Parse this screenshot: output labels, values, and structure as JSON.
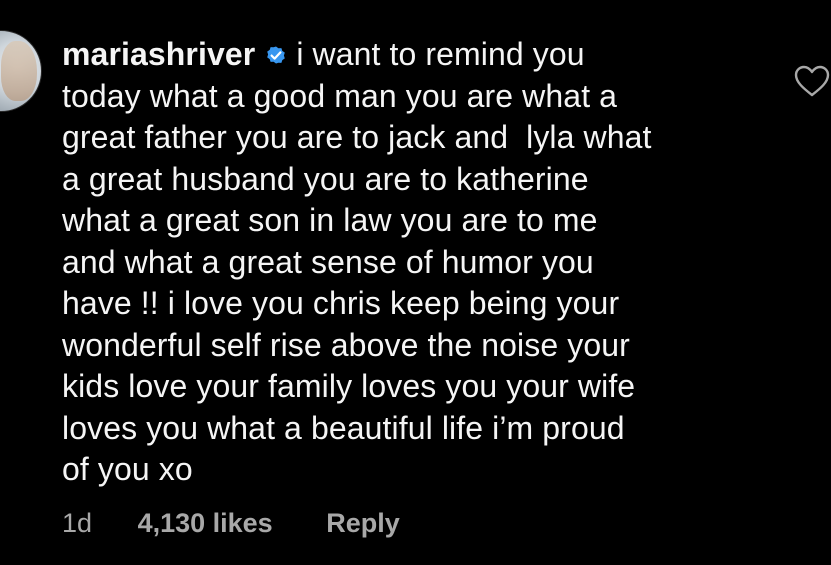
{
  "comment": {
    "username": "mariashriver",
    "verified": true,
    "text_lines": [
      "i want to remind you",
      "today what a good man you are what a",
      "great father you are to jack and  lyla what",
      "a great husband you are to katherine",
      "what a great son in law you are to me",
      "and what a great sense of humor you",
      "have !! i love you chris keep being your",
      "wonderful self rise above the noise your",
      "kids love your family loves you your wife",
      "loves you what a beautiful life i’m proud",
      "of you xo"
    ],
    "time": "1d",
    "likes": "4,130 likes",
    "reply_label": "Reply",
    "icons": {
      "avatar": "avatar",
      "verified": "verified-badge-icon",
      "like": "heart-outline-icon"
    },
    "colors": {
      "background": "#000000",
      "text": "#f5f5f5",
      "meta": "#a8a8a8",
      "verified": "#3897f0"
    }
  }
}
